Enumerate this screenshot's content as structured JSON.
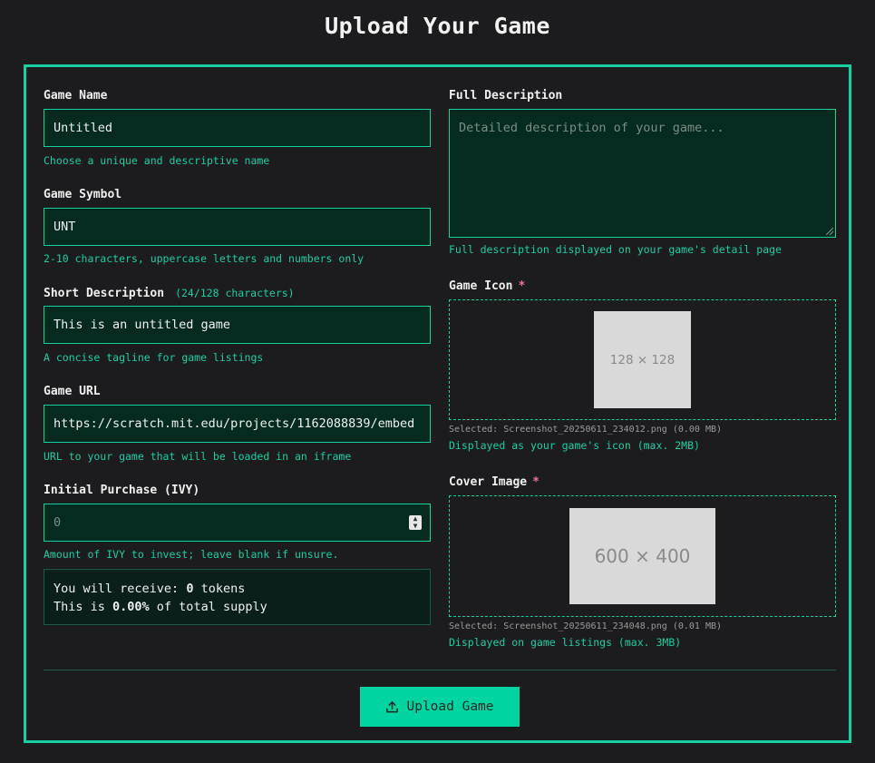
{
  "page": {
    "title": "Upload Your Game"
  },
  "form": {
    "game_name": {
      "label": "Game Name",
      "value": "Untitled",
      "help": "Choose a unique and descriptive name"
    },
    "game_symbol": {
      "label": "Game Symbol",
      "value": "UNT",
      "help": "2-10 characters, uppercase letters and numbers only"
    },
    "short_description": {
      "label": "Short Description",
      "counter": "(24/128 characters)",
      "value": "This is an untitled game",
      "help": "A concise tagline for game listings"
    },
    "game_url": {
      "label": "Game URL",
      "value": "https://scratch.mit.edu/projects/1162088839/embed",
      "help": "URL to your game that will be loaded in an iframe"
    },
    "initial_purchase": {
      "label": "Initial Purchase (IVY)",
      "placeholder": "0",
      "help": "Amount of IVY to invest; leave blank if unsure."
    },
    "receive": {
      "line1_prefix": "You will receive: ",
      "tokens": "0",
      "line1_suffix": " tokens",
      "line2_prefix": "This is ",
      "percent": "0.00%",
      "line2_suffix": " of total supply"
    },
    "full_description": {
      "label": "Full Description",
      "placeholder": "Detailed description of your game...",
      "help": "Full description displayed on your game's detail page"
    },
    "game_icon": {
      "label": "Game Icon",
      "required_mark": "*",
      "preview_text": "128 × 128",
      "selected": "Selected: Screenshot_20250611_234012.png (0.00 MB)",
      "help": "Displayed as your game's icon (max. 2MB)"
    },
    "cover_image": {
      "label": "Cover Image",
      "required_mark": "*",
      "preview_text": "600 × 400",
      "selected": "Selected: Screenshot_20250611_234048.png (0.01 MB)",
      "help": "Displayed on game listings (max. 3MB)"
    },
    "submit_label": "Upload Game",
    "submit_icon": "upload-icon"
  },
  "colors": {
    "accent": "#18cfa2",
    "button": "#00d4a0",
    "background": "#1c1c1e",
    "field_bg": "#052b20",
    "required": "#ff6b9d"
  }
}
